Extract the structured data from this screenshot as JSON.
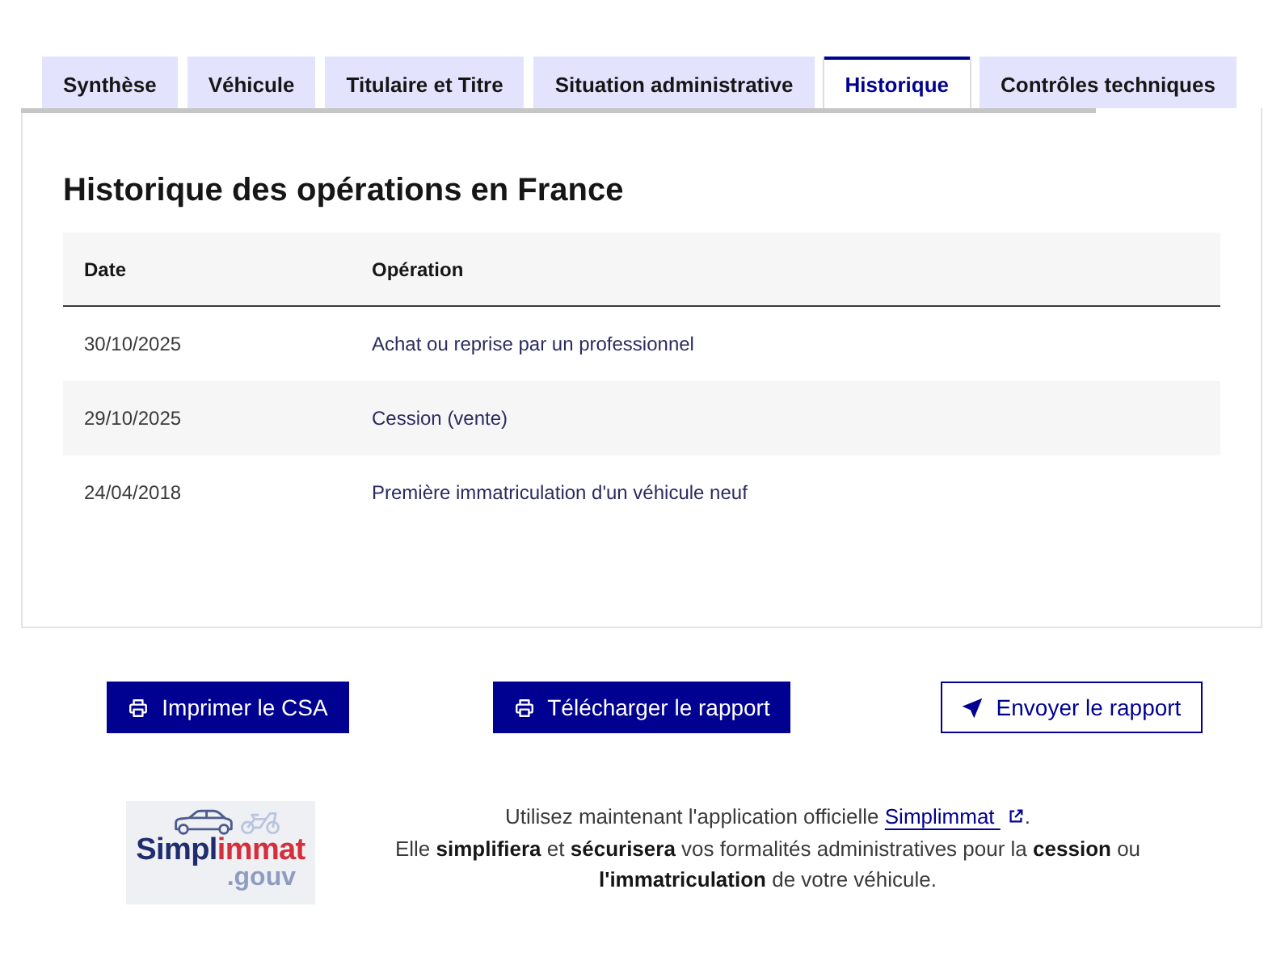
{
  "tabs": [
    {
      "label": "Synthèse",
      "selected": false
    },
    {
      "label": "Véhicule",
      "selected": false
    },
    {
      "label": "Titulaire et Titre",
      "selected": false
    },
    {
      "label": "Situation administrative",
      "selected": false
    },
    {
      "label": "Historique",
      "selected": true
    },
    {
      "label": "Contrôles techniques",
      "selected": false
    }
  ],
  "section": {
    "title": "Historique des opérations en France",
    "table": {
      "columns": [
        "Date",
        "Opération"
      ],
      "rows": [
        {
          "date": "30/10/2025",
          "operation": "Achat ou reprise par un professionnel"
        },
        {
          "date": "29/10/2025",
          "operation": "Cession (vente)"
        },
        {
          "date": "24/04/2018",
          "operation": "Première immatriculation d'un véhicule neuf"
        }
      ]
    }
  },
  "actions": [
    {
      "label": "Imprimer le CSA",
      "kind": "primary"
    },
    {
      "label": "Télécharger le rapport",
      "kind": "primary"
    },
    {
      "label": "Envoyer le rapport",
      "kind": "secondary"
    }
  ],
  "promo": {
    "logo": {
      "parts": [
        {
          "text": "Simpl",
          "color": "#1f2c6e"
        },
        {
          "text": "immat",
          "color": "#d3303c"
        }
      ],
      "suffix": ".gouv"
    },
    "text_before": "Utilisez maintenant l'application officielle",
    "link": "Simplimmat",
    "text_after": ".",
    "text_2": "Elle **simplifiera** et **sécurisera** vos formalités administratives pour la **cession** ou **l'immatriculation** de votre véhicule."
  }
}
